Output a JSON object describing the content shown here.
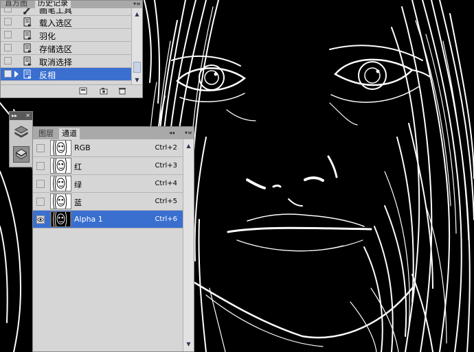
{
  "history": {
    "tabs": [
      "直方图",
      "历史记录"
    ],
    "steps": [
      {
        "label": "画笔工具",
        "icon": "brush-icon",
        "selected": false
      },
      {
        "label": "载入选区",
        "icon": "history-state-icon",
        "selected": false
      },
      {
        "label": "羽化",
        "icon": "history-state-icon",
        "selected": false
      },
      {
        "label": "存储选区",
        "icon": "history-state-icon",
        "selected": false
      },
      {
        "label": "取消选择",
        "icon": "history-state-icon",
        "selected": false
      },
      {
        "label": "反相",
        "icon": "history-state-icon",
        "selected": true
      }
    ],
    "footer_icons": [
      "new-document-from-state-icon",
      "snapshot-camera-icon",
      "trash-icon"
    ]
  },
  "tool_strip": {
    "icons": [
      "layers-icon",
      "channels-icon"
    ],
    "active": "channels-icon"
  },
  "channels": {
    "tabs": [
      "图层",
      "通道"
    ],
    "active_tab": "通道",
    "rows": [
      {
        "name": "RGB",
        "shortcut": "Ctrl+2",
        "visible": false,
        "selected": false
      },
      {
        "name": "红",
        "shortcut": "Ctrl+3",
        "visible": false,
        "selected": false
      },
      {
        "name": "绿",
        "shortcut": "Ctrl+4",
        "visible": false,
        "selected": false
      },
      {
        "name": "蓝",
        "shortcut": "Ctrl+5",
        "visible": false,
        "selected": false
      },
      {
        "name": "Alpha 1",
        "shortcut": "Ctrl+6",
        "visible": true,
        "selected": true
      }
    ]
  },
  "colors": {
    "selection": "#3a6fd0",
    "panel_bg": "#d6d6d6",
    "canvas_bg": "#000000",
    "canvas_lines": "#ffffff"
  }
}
